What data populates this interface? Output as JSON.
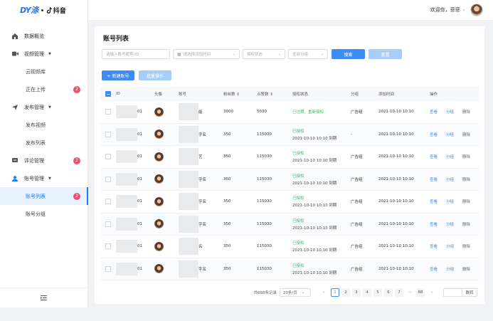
{
  "logo": {
    "brand": "DY涤",
    "partner": "抖音"
  },
  "header": {
    "welcome": "欢迎你，菲菲"
  },
  "sidebar": {
    "items": [
      {
        "label": "数据概览",
        "icon": "home-icon",
        "type": "group"
      },
      {
        "label": "视频管理",
        "icon": "video-icon",
        "type": "group",
        "caret": "▼"
      },
      {
        "label": "云视频库",
        "type": "sub"
      },
      {
        "label": "正在上传",
        "type": "sub",
        "badge": "2"
      },
      {
        "label": "发布管理",
        "icon": "send-icon",
        "type": "group",
        "caret": "▼"
      },
      {
        "label": "发布视频",
        "type": "sub"
      },
      {
        "label": "发布列表",
        "type": "sub"
      },
      {
        "label": "评论管理",
        "icon": "comment-icon",
        "type": "group",
        "badge": "2"
      },
      {
        "label": "账号管理",
        "icon": "user-icon",
        "type": "group",
        "caret": "▼",
        "active_group": true
      },
      {
        "label": "账号列表",
        "type": "sub",
        "badge": "2",
        "active": true
      },
      {
        "label": "账号分组",
        "type": "sub"
      }
    ]
  },
  "page": {
    "title": "账号列表"
  },
  "filters": {
    "account_placeholder": "请输入账号昵称/ID",
    "time_placeholder": "请选择添加时间",
    "status_placeholder": "授权状态",
    "group_placeholder": "全部分组",
    "search_label": "搜索",
    "reset_label": "重置"
  },
  "actions": {
    "new_label": "+ 新建账号",
    "batch_label": "批量操作"
  },
  "table": {
    "headers": {
      "id": "ID",
      "avatar": "头像",
      "account": "账号",
      "fans": "粉丝数 ⇕",
      "likes": "点赞数 ⇕",
      "auth": "授权状态",
      "group": "分组",
      "time": "添加时间",
      "ops": "操作"
    },
    "rows": [
      {
        "id_tail": "01",
        "acc_tail": "能",
        "fans": "3000",
        "likes": "5030",
        "auth_line1": "已过期，重新授权",
        "auth_line2": "",
        "group": "广告组",
        "time": "2021-10-10 10:10"
      },
      {
        "id_tail": "01",
        "acc_tail": "字名",
        "fans": "350",
        "likes": "115030",
        "auth_line1": "已授权",
        "auth_line2": "2021-10-10 10:10 到期",
        "group": "-",
        "time": "2021-10-10 10:10"
      },
      {
        "id_tail": "01",
        "acc_tail": "艺",
        "fans": "350",
        "likes": "115030",
        "auth_line1": "已授权",
        "auth_line2": "2021-10-10 10:10 到期",
        "group": "广告组",
        "time": "2021-10-10 10:10"
      },
      {
        "id_tail": "01",
        "acc_tail": "字名",
        "fans": "350",
        "likes": "115030",
        "auth_line1": "已授权",
        "auth_line2": "2021-10-10 10:10 到期",
        "group": "广告组",
        "time": "2021-10-10 10:10"
      },
      {
        "id_tail": "01",
        "acc_tail": "字名",
        "fans": "350",
        "likes": "115030",
        "auth_line1": "已授权",
        "auth_line2": "2021-10-10 10:10 到期",
        "group": "广告组",
        "time": "2021-10-10 10:10"
      },
      {
        "id_tail": "01",
        "acc_tail": "字名",
        "fans": "350",
        "likes": "115030",
        "auth_line1": "已授权",
        "auth_line2": "2021-10-10 10:10 到期",
        "group": "广告组",
        "time": "2021-10-10 10:10"
      },
      {
        "id_tail": "01",
        "acc_tail": "名",
        "fans": "350",
        "likes": "115030",
        "auth_line1": "已授权",
        "auth_line2": "2021-10-10 10:10 到期",
        "group": "广告组",
        "time": "2021-10-10 10:10"
      },
      {
        "id_tail": "01",
        "acc_tail": "字名",
        "fans": "350",
        "likes": "115030",
        "auth_line1": "已授权",
        "auth_line2": "2021-10-10 10:10 到期",
        "group": "广告组",
        "time": "2021-10-10 10:10"
      }
    ],
    "ops": {
      "view": "查看",
      "group": "分组",
      "delete": "删除"
    }
  },
  "pagination": {
    "total": "共888条记录",
    "page_size": "20条/页",
    "pages": [
      "1",
      "2",
      "3",
      "4",
      "5",
      "6",
      "7",
      "···",
      "88"
    ],
    "current": "1",
    "prev": "‹",
    "next": "›",
    "jump_label": "跳转"
  }
}
